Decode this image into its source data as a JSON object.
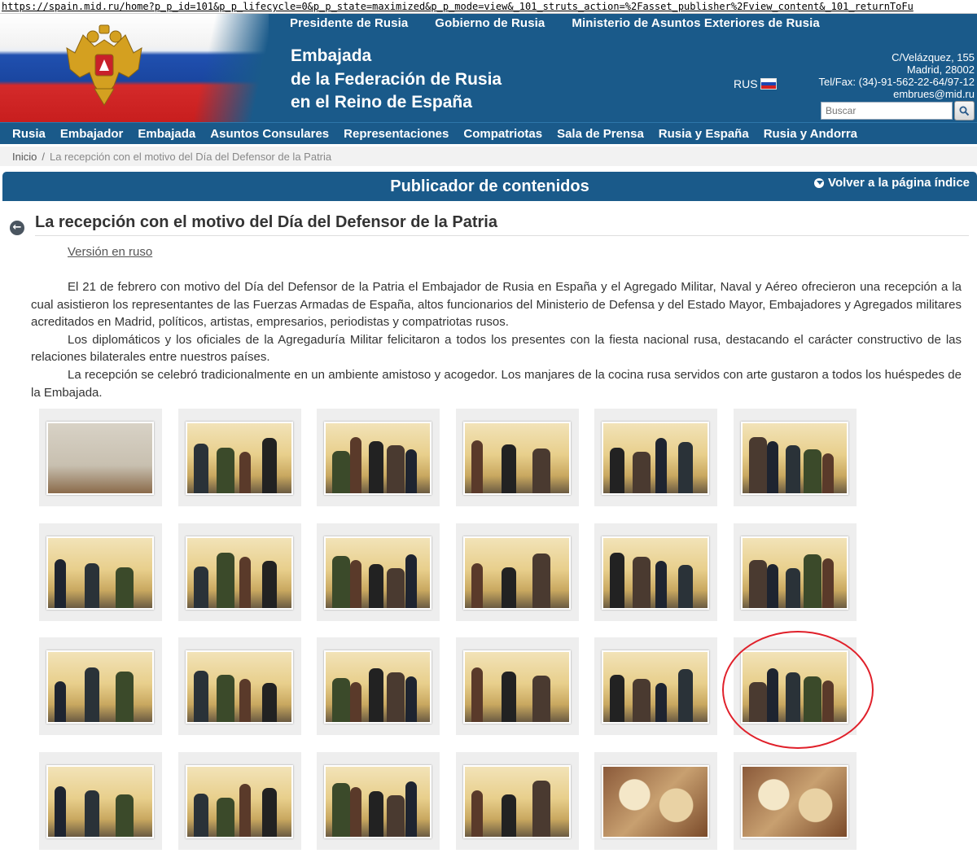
{
  "browser": {
    "url": "https://spain.mid.ru/home?p_p_id=101&p_p_lifecycle=0&p_p_state=maximized&p_p_mode=view&_101_struts_action=%2Fasset_publisher%2Fview_content&_101_returnToFu"
  },
  "header": {
    "top_links": [
      "Presidente de Rusia",
      "Gobierno de Rusia",
      "Ministerio de Asuntos Exteriores de Rusia"
    ],
    "title_line1": "Embajada",
    "title_line2": "de la Federación de Rusia",
    "title_line3": "en el Reino de España",
    "language": "RUS",
    "address_line1": "C/Velázquez, 155",
    "address_line2": "Madrid, 28002",
    "phone": "Tel/Fax: (34)-91-562-22-64/97-12",
    "email": "embrues@mid.ru",
    "search_placeholder": "Buscar"
  },
  "nav": {
    "items": [
      "Rusia",
      "Embajador",
      "Embajada",
      "Asuntos Consulares",
      "Representaciones",
      "Compatriotas",
      "Sala de Prensa",
      "Rusia y España",
      "Rusia y Andorra"
    ]
  },
  "breadcrumb": {
    "home": "Inicio",
    "separator": "/",
    "current": "La recepción con el motivo del Día del Defensor de la Patria"
  },
  "portlet": {
    "title": "Publicador de contenidos",
    "back_label": "Volver a la página índice"
  },
  "article": {
    "back_icon": "arrow-left-icon",
    "title": "La recepción con el motivo del Día del Defensor de la Patria",
    "version_link": "Versión en ruso",
    "paragraphs": [
      "El 21 de febrero con motivo del Día del Defensor de la Patria el Embajador de Rusia en España y el Agregado Militar, Naval y Aéreo ofrecieron una recepción a la cual asistieron los representantes de las Fuerzas Armadas de España, altos funcionarios del Ministerio de Defensa y del Estado Mayor, Embajadores y Agregados militares acreditados en Madrid, políticos, artistas, empresarios, periodistas y compatriotas rusos.",
      "Los diplomáticos y los oficiales de la Agregaduría Militar felicitaron a todos los presentes con la fiesta nacional rusa, destacando el carácter constructivo de las relaciones bilaterales entre nuestros países.",
      "La recepción se celebró tradicionalmente en un ambiente amistoso y acogedor. Los manjares de la cocina rusa servidos con arte gustaron a todos los huéspedes de la Embajada."
    ]
  },
  "gallery": {
    "rows": 4,
    "columns": 6,
    "highlighted_index": 17
  },
  "colors": {
    "header_blue": "#1a5a8a",
    "highlight_red": "#e0202a"
  }
}
